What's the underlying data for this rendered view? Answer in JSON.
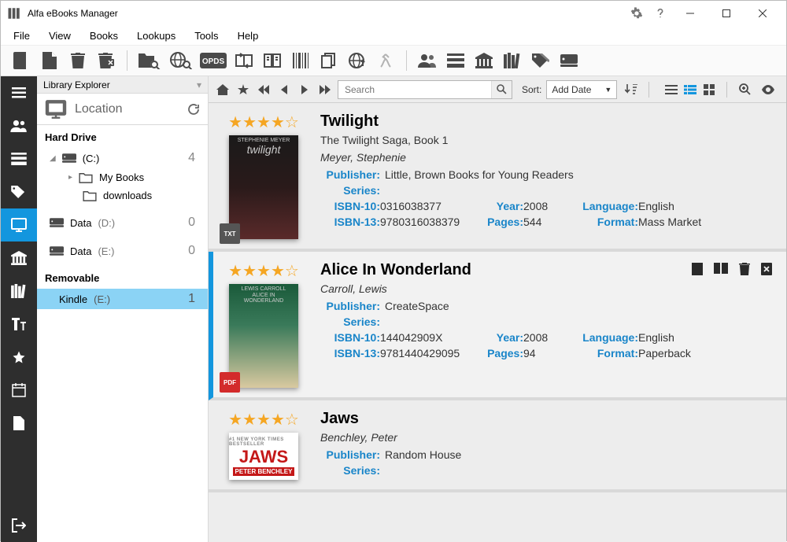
{
  "app": {
    "title": "Alfa eBooks Manager"
  },
  "menu": {
    "file": "File",
    "view": "View",
    "books": "Books",
    "lookups": "Lookups",
    "tools": "Tools",
    "help": "Help"
  },
  "explorer": {
    "panel_title": "Library Explorer",
    "location": "Location",
    "hard_drive": "Hard Drive",
    "removable": "Removable",
    "drives": [
      {
        "name": "(C:)",
        "count": "4"
      },
      {
        "name_pre": "Data",
        "name_id": "(D:)",
        "count": "0"
      },
      {
        "name_pre": "Data",
        "name_id": "(E:)",
        "count": "0"
      }
    ],
    "folders": [
      {
        "name": "My Books"
      },
      {
        "name": "downloads"
      }
    ],
    "kindle": {
      "name": "Kindle",
      "name_id": "(E:)",
      "count": "1"
    }
  },
  "filterbar": {
    "search_placeholder": "Search",
    "sort_label": "Sort:",
    "sort_value": "Add Date"
  },
  "books": [
    {
      "title": "Twilight",
      "subtitle": "The Twilight Saga, Book 1",
      "author": "Meyer, Stephenie",
      "publisher_label": "Publisher:",
      "publisher": "Little, Brown Books for Young Readers",
      "series_label": "Series:",
      "isbn10_label": "ISBN-10:",
      "isbn10": "0316038377",
      "isbn13_label": "ISBN-13:",
      "isbn13": "9780316038379",
      "year_label": "Year:",
      "year": "2008",
      "pages_label": "Pages:",
      "pages": "544",
      "lang_label": "Language:",
      "lang": "English",
      "format_label": "Format:",
      "format": "Mass Market",
      "stars": "★★★★☆",
      "badge": "TXT",
      "cover_text": "STEPHENIE MEYER\\ntwilight"
    },
    {
      "title": "Alice In Wonderland",
      "subtitle": "",
      "author": "Carroll, Lewis",
      "publisher_label": "Publisher:",
      "publisher": "CreateSpace",
      "series_label": "Series:",
      "isbn10_label": "ISBN-10:",
      "isbn10": "144042909X",
      "isbn13_label": "ISBN-13:",
      "isbn13": "9781440429095",
      "year_label": "Year:",
      "year": "2008",
      "pages_label": "Pages:",
      "pages": "94",
      "lang_label": "Language:",
      "lang": "English",
      "format_label": "Format:",
      "format": "Paperback",
      "stars": "★★★★☆",
      "badge": "PDF",
      "cover_text": "LEWIS CARROLL\\nALICE IN\\nWONDERLAND"
    },
    {
      "title": "Jaws",
      "subtitle": "",
      "author": "Benchley, Peter",
      "publisher_label": "Publisher:",
      "publisher": "Random House",
      "series_label": "Series:",
      "stars": "★★★★☆",
      "cover_text": "JAWS\\nPETER BENCHLEY"
    }
  ]
}
